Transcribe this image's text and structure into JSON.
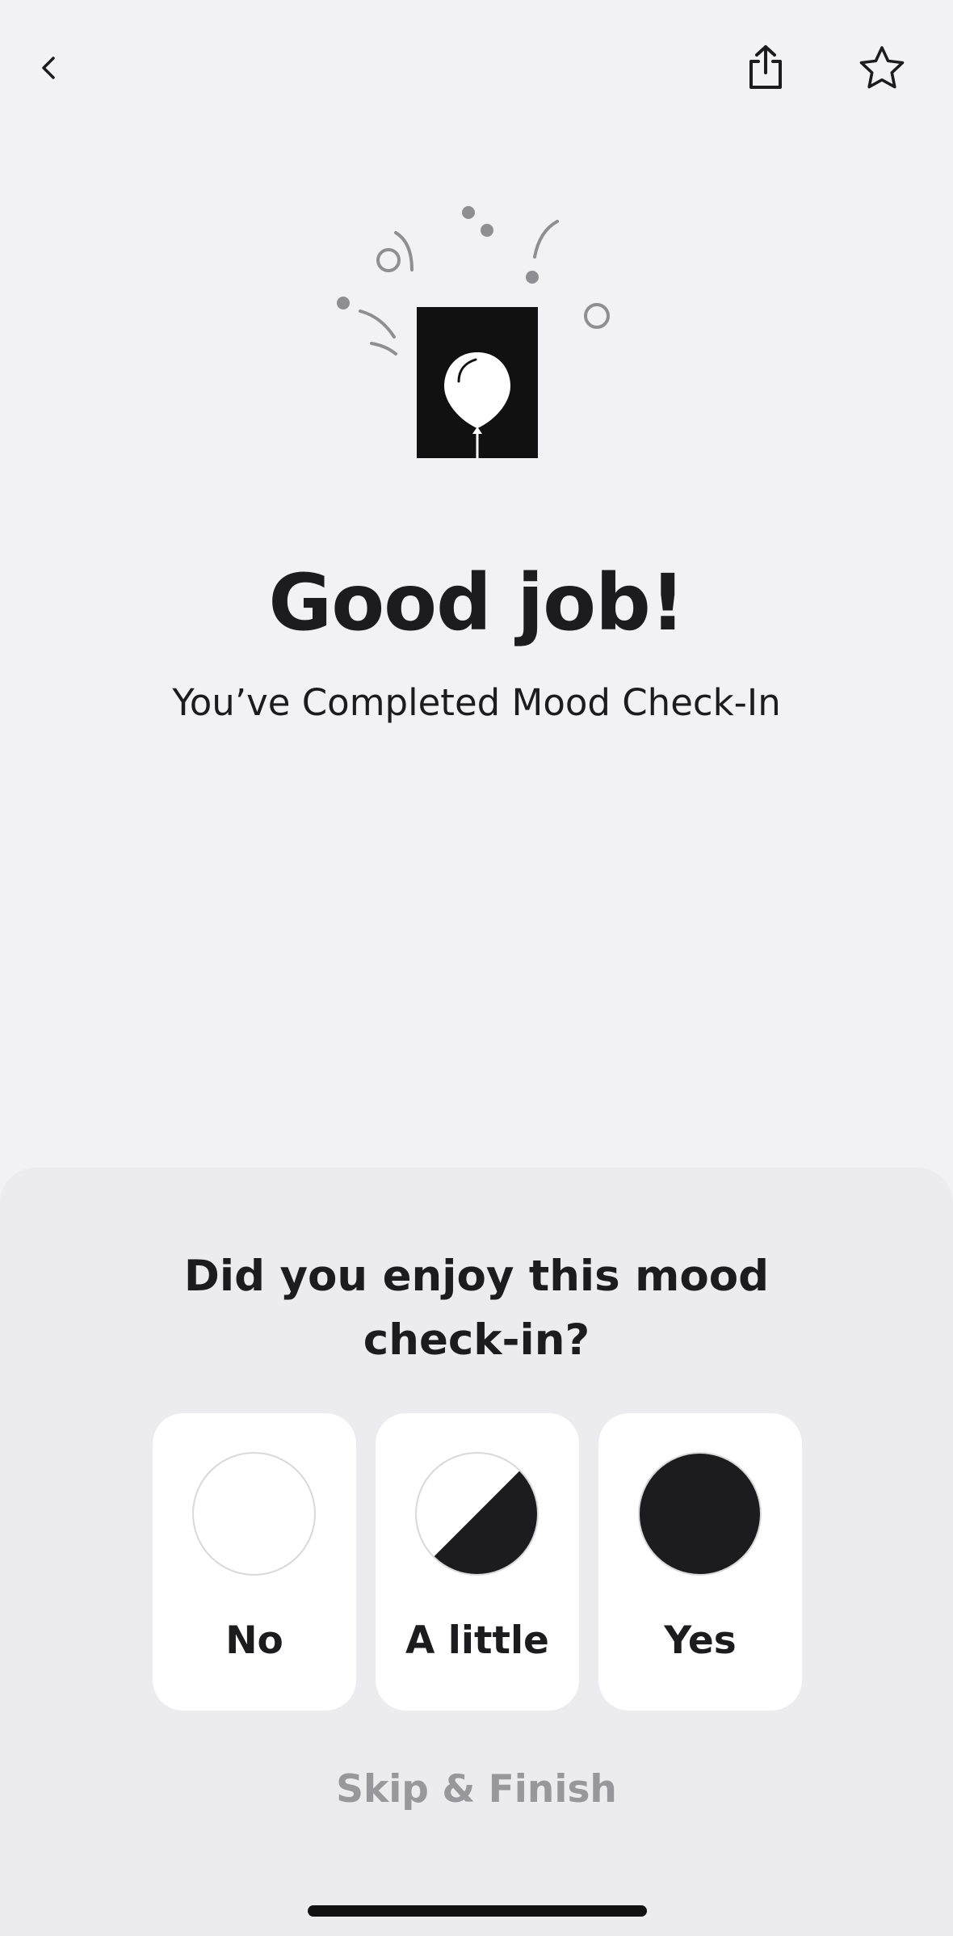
{
  "header": {
    "back_icon": "chevron-left-icon",
    "share_icon": "share-icon",
    "favorite_icon": "star-outline-icon"
  },
  "illustration": {
    "icon": "balloon-celebration-icon"
  },
  "completion": {
    "title": "Good job!",
    "subtitle": "You’ve Completed Mood Check-In"
  },
  "feedback": {
    "question": "Did you enjoy this mood check-in?",
    "options": [
      {
        "label": "No",
        "icon": "empty-circle-icon"
      },
      {
        "label": "A little",
        "icon": "half-filled-circle-icon"
      },
      {
        "label": "Yes",
        "icon": "filled-circle-icon"
      }
    ],
    "skip_label": "Skip & Finish"
  },
  "colors": {
    "background": "#f2f2f4",
    "sheet": "#ecebee",
    "primary_text": "#1c1b1d",
    "muted_text": "#98979b"
  }
}
